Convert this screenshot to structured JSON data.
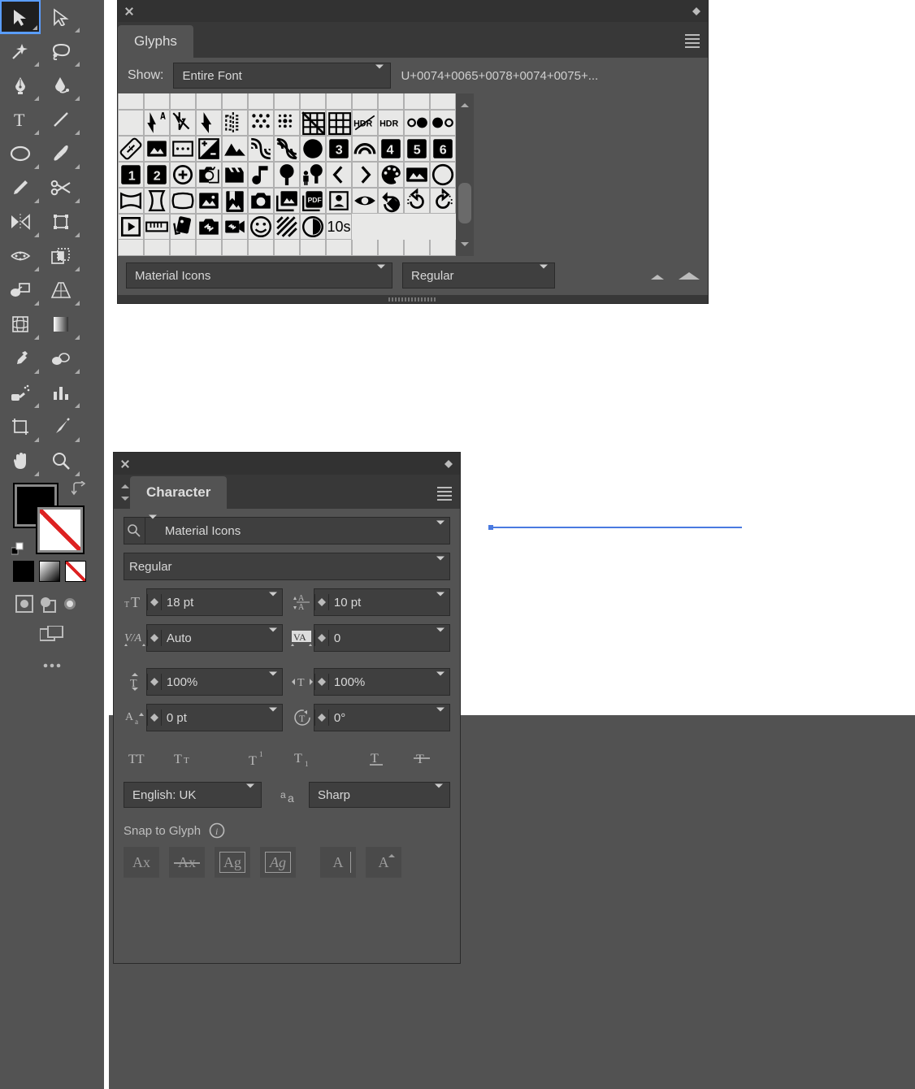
{
  "toolbox": {
    "tools": [
      [
        "selection-tool",
        "direct-selection-tool"
      ],
      [
        "magic-wand-tool",
        "lasso-tool"
      ],
      [
        "pen-tool",
        "curvature-tool"
      ],
      [
        "type-tool",
        "line-segment-tool"
      ],
      [
        "ellipse-tool",
        "paintbrush-tool"
      ],
      [
        "pencil-tool",
        "scissors-tool"
      ],
      [
        "reflect-tool",
        "free-transform-tool"
      ],
      [
        "width-tool",
        "shape-builder-tool"
      ],
      [
        "blend-tool",
        "perspective-tool"
      ],
      [
        "mesh-tool",
        "gradient-tool"
      ],
      [
        "eyedropper-tool",
        "live-paint-tool"
      ],
      [
        "symbol-sprayer-tool",
        "column-graph-tool"
      ],
      [
        "artboard-tool",
        "slice-tool"
      ],
      [
        "hand-tool",
        "zoom-tool"
      ]
    ],
    "fill_color": "#000000",
    "stroke_color": "none"
  },
  "glyphs_panel": {
    "tab": "Glyphs",
    "show_label": "Show:",
    "filter": "Entire Font",
    "unicode_readout": "U+0074+0065+0078+0074+0075+...",
    "font_family": "Material Icons",
    "font_style": "Regular",
    "grid_icons": [
      "flash-auto-icon",
      "flash-off-icon",
      "flash-on-icon",
      "flip-icon",
      "grain-icon",
      "blur-icon",
      "grid-off-icon",
      "grid-on-icon",
      "hdr-off-icon",
      "hdr-on-icon",
      "hdr-strong-icon",
      "hdr-weak-icon",
      "healing-icon",
      "image-icon",
      "aspect-ratio-icon",
      "exposure-icon",
      "landscape-icon",
      "leak-add-icon",
      "leak-remove-icon",
      "lens-icon",
      "looks-3-icon",
      "looks-icon",
      "looks-4-icon",
      "looks-5-icon",
      "looks-6-icon",
      "looks-one-icon",
      "looks-two-icon",
      "loupe-icon",
      "monochrome-photos-icon",
      "movie-creation-icon",
      "music-note-icon",
      "nature-icon",
      "nature-people-icon",
      "navigate-before-icon",
      "navigate-next-icon",
      "palette-icon",
      "panorama-icon",
      "panorama-fisheye-icon",
      "panorama-horizontal-icon",
      "panorama-vertical-icon",
      "panorama-wide-angle-icon",
      "photo-icon",
      "photo-album-icon",
      "photo-camera-icon",
      "photo-library-icon",
      "picture-as-pdf-icon",
      "portrait-icon",
      "remove-red-eye-icon",
      "rotate-90-ccw-icon",
      "rotate-left-icon",
      "rotate-right-icon",
      "slideshow-icon",
      "straighten-icon",
      "style-icon",
      "switch-camera-icon",
      "switch-video-icon",
      "tag-faces-icon",
      "texture-icon",
      "timelapse-icon",
      "timer-10-icon"
    ],
    "timer10_label": "10s"
  },
  "character_panel": {
    "tab": "Character",
    "font_family": "Material Icons",
    "font_style": "Regular",
    "font_size": "18 pt",
    "leading": "10 pt",
    "kerning": "Auto",
    "tracking": "0",
    "vscale": "100%",
    "hscale": "100%",
    "baseline_shift": "0 pt",
    "rotation": "0°",
    "language": "English: UK",
    "antialias": "Sharp",
    "snap_label": "Snap to Glyph",
    "snap_buttons": [
      "Ax",
      "Ax",
      "Ag",
      "Ag",
      "A",
      "A"
    ]
  }
}
